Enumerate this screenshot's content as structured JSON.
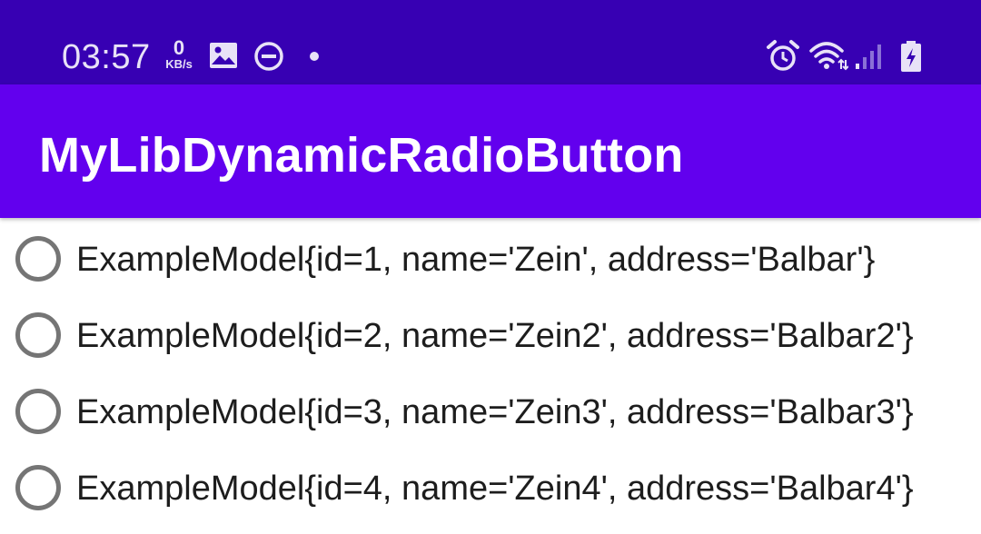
{
  "status_bar": {
    "time": "03:57",
    "net_speed_value": "0",
    "net_speed_unit": "KB/s",
    "left_icons": [
      "image-icon",
      "do-not-disturb-icon",
      "dot-icon"
    ],
    "right_icons": [
      "alarm-icon",
      "wifi-icon",
      "signal-icon",
      "battery-charging-icon"
    ],
    "background_color": "#3700b3"
  },
  "app_bar": {
    "title": "MyLibDynamicRadioButton",
    "background_color": "#6200ee"
  },
  "radio_group": {
    "items": [
      {
        "label": "ExampleModel{id=1, name='Zein', address='Balbar'}",
        "checked": false
      },
      {
        "label": "ExampleModel{id=2, name='Zein2', address='Balbar2'}",
        "checked": false
      },
      {
        "label": "ExampleModel{id=3, name='Zein3', address='Balbar3'}",
        "checked": false
      },
      {
        "label": "ExampleModel{id=4, name='Zein4', address='Balbar4'}",
        "checked": false
      }
    ]
  }
}
